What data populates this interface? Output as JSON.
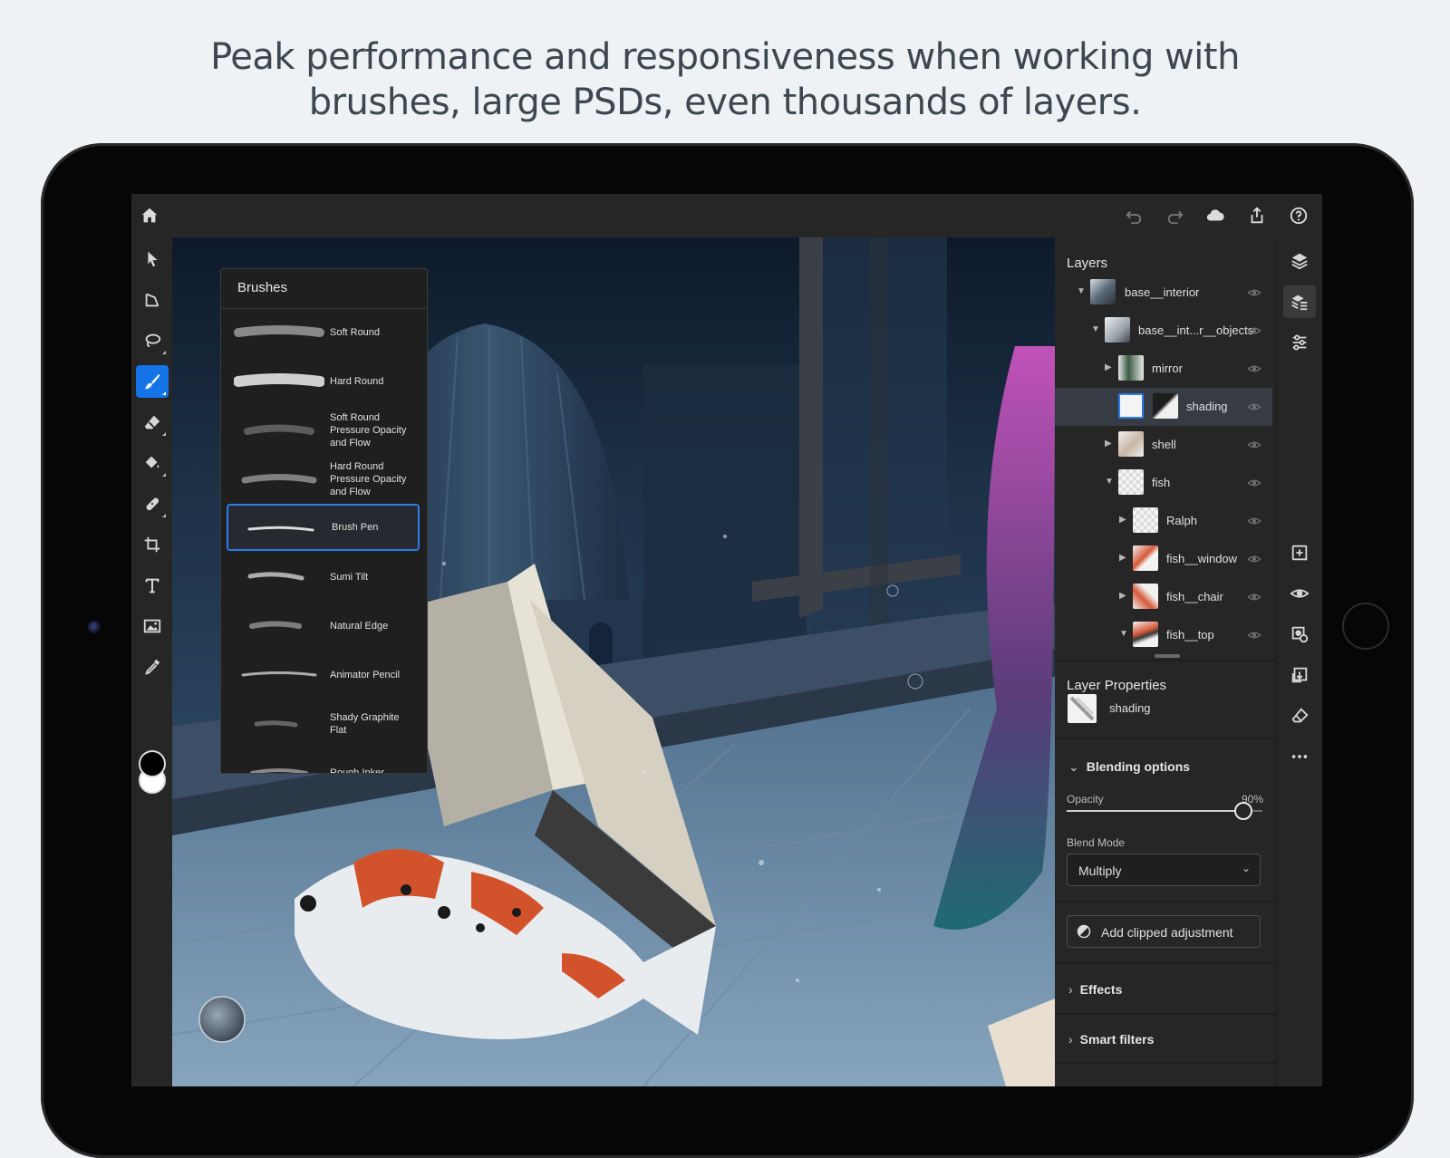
{
  "headline": {
    "line1": "Peak performance and responsiveness when working with",
    "line2": "brushes, large PSDs, even thousands of layers."
  },
  "brushes_panel": {
    "title": "Brushes",
    "items": [
      {
        "label": "Soft Round",
        "selected": false
      },
      {
        "label": "Hard Round",
        "selected": false
      },
      {
        "label": "Soft Round Pressure Opacity and Flow",
        "selected": false
      },
      {
        "label": "Hard Round Pressure Opacity and Flow",
        "selected": false
      },
      {
        "label": "Brush Pen",
        "selected": true
      },
      {
        "label": "Sumi Tilt",
        "selected": false
      },
      {
        "label": "Natural Edge",
        "selected": false
      },
      {
        "label": "Animator Pencil",
        "selected": false
      },
      {
        "label": "Shady Graphite Flat",
        "selected": false
      },
      {
        "label": "Rough Inker",
        "selected": false
      }
    ]
  },
  "layers_panel": {
    "title": "Layers",
    "layers": [
      {
        "name": "base__interior"
      },
      {
        "name": "base__int...r__objects"
      },
      {
        "name": "mirror"
      },
      {
        "name": "shading"
      },
      {
        "name": "shell"
      },
      {
        "name": "fish"
      },
      {
        "name": "Ralph"
      },
      {
        "name": "fish__window"
      },
      {
        "name": "fish__chair"
      },
      {
        "name": "fish__top"
      }
    ]
  },
  "layer_properties": {
    "title": "Layer Properties",
    "layer_name": "shading",
    "blending_title": "Blending options",
    "opacity_label": "Opacity",
    "opacity_value": "90%",
    "opacity_fraction": 0.9,
    "blend_mode_label": "Blend Mode",
    "blend_mode_value": "Multiply",
    "add_clipped_label": "Add clipped adjustment",
    "effects_label": "Effects",
    "smart_filters_label": "Smart filters"
  },
  "colors": {
    "accent": "#1473e6",
    "panel_bg": "#262626",
    "selected_row": "#363b44",
    "foreground_swatch": "#000000",
    "background_swatch": "#ffffff"
  }
}
